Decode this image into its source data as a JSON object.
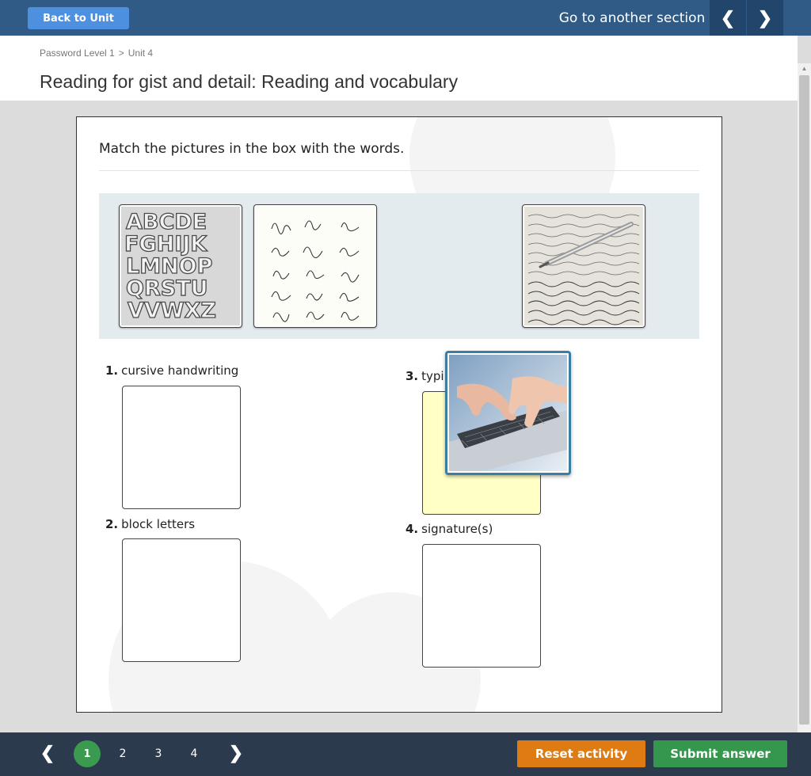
{
  "topbar": {
    "back_label": "Back to Unit",
    "goto_label": "Go to another section",
    "prev_icon": "❮",
    "next_icon": "❯"
  },
  "breadcrumb": {
    "level": "Password Level 1",
    "separator": ">",
    "unit": "Unit 4"
  },
  "page_title": "Reading for gist and detail: Reading and vocabulary",
  "activity": {
    "instruction": "Match the pictures in the box with the words.",
    "pictures": [
      {
        "name": "block-letters-image",
        "letters": [
          "ABCDE",
          "FGHIJK",
          "LMNOP",
          "QRSTU",
          "VVWXZ"
        ]
      },
      {
        "name": "signatures-image"
      },
      {
        "name": "cursive-handwriting-image"
      }
    ],
    "dragging_picture": "typing-image",
    "questions": [
      {
        "num": "1.",
        "label": "cursive handwriting"
      },
      {
        "num": "2.",
        "label": "block letters"
      },
      {
        "num": "3.",
        "label": "typi"
      },
      {
        "num": "4.",
        "label": "signature(s)"
      }
    ]
  },
  "pagination": {
    "prev_icon": "❮",
    "next_icon": "❯",
    "pages": [
      "1",
      "2",
      "3",
      "4"
    ],
    "current": "1"
  },
  "actions": {
    "reset_label": "Reset activity",
    "submit_label": "Submit answer"
  },
  "colors": {
    "topbar": "#2f5b86",
    "back_button": "#4d90e0",
    "bottombar": "#2b3b4d",
    "reset": "#de7b12",
    "submit": "#35964e",
    "active_page": "#3a9a4f",
    "drop_highlight": "#ffffc6"
  }
}
